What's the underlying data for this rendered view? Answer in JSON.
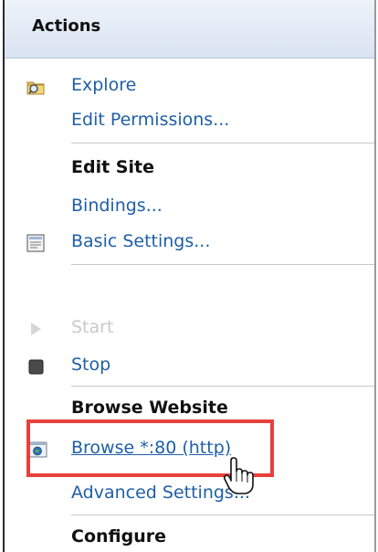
{
  "panel": {
    "title": "Actions"
  },
  "items": {
    "explore": {
      "label": "Explore",
      "icon": "explore-folder-icon"
    },
    "edit_permissions": {
      "label": "Edit Permissions..."
    },
    "edit_site_heading": "Edit Site",
    "bindings": {
      "label": "Bindings..."
    },
    "basic_settings": {
      "label": "Basic Settings...",
      "icon": "settings-document-icon"
    },
    "start": {
      "label": "Start",
      "icon": "play-icon",
      "state": "disabled"
    },
    "stop": {
      "label": "Stop",
      "icon": "stop-icon"
    },
    "browse_website_heading": "Browse Website",
    "browse": {
      "label": "Browse *:80 (http)",
      "icon": "globe-browse-icon",
      "state": "hovered"
    },
    "advanced_settings": {
      "label": "Advanced Settings..."
    },
    "configure_heading": "Configure"
  },
  "colors": {
    "link": "#1f5fa6",
    "disabled": "#c9c9c9",
    "highlight": "#e8403c",
    "header_bg": "#dfe8f4"
  },
  "cursor": {
    "icon": "hand-pointer-icon"
  }
}
